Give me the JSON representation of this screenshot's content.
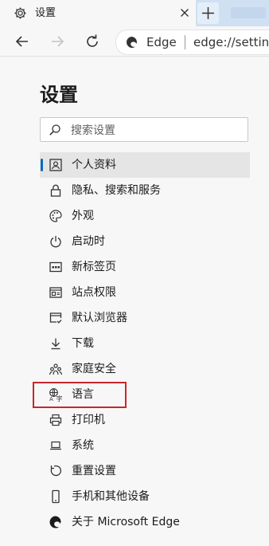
{
  "tab": {
    "title": "设置",
    "icon": "gear-icon"
  },
  "toolbar": {
    "back_icon": "back-arrow-icon",
    "forward_icon": "forward-arrow-icon",
    "refresh_icon": "refresh-icon",
    "address": {
      "brand": "Edge",
      "url": "edge://settings"
    }
  },
  "page": {
    "title": "设置",
    "search_placeholder": "搜索设置"
  },
  "nav": {
    "items": [
      {
        "label": "个人资料",
        "icon": "profile-icon",
        "active": true
      },
      {
        "label": "隐私、搜索和服务",
        "icon": "lock-icon"
      },
      {
        "label": "外观",
        "icon": "palette-icon"
      },
      {
        "label": "启动时",
        "icon": "power-icon"
      },
      {
        "label": "新标签页",
        "icon": "new-tab-icon"
      },
      {
        "label": "站点权限",
        "icon": "site-permissions-icon"
      },
      {
        "label": "默认浏览器",
        "icon": "default-browser-icon"
      },
      {
        "label": "下载",
        "icon": "download-icon"
      },
      {
        "label": "家庭安全",
        "icon": "family-icon"
      },
      {
        "label": "语言",
        "icon": "language-icon",
        "highlighted": true
      },
      {
        "label": "打印机",
        "icon": "printer-icon"
      },
      {
        "label": "系统",
        "icon": "system-icon"
      },
      {
        "label": "重置设置",
        "icon": "reset-icon"
      },
      {
        "label": "手机和其他设备",
        "icon": "phone-icon"
      },
      {
        "label": "关于 Microsoft Edge",
        "icon": "edge-logo-icon"
      }
    ]
  },
  "colors": {
    "accent": "#0f6cbd",
    "highlight_box": "#c8262e",
    "tabstrip": "#cfe0f3"
  }
}
